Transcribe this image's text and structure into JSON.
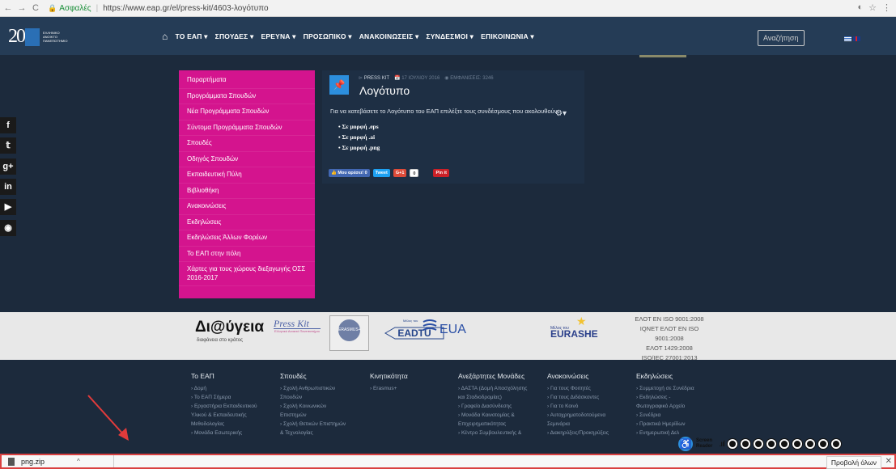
{
  "browser": {
    "secure_label": "Ασφαλές",
    "url": "https://www.eap.gr/el/press-kit/4603-λογότυπο",
    "back_icon": "back-arrow-icon",
    "forward_icon": "forward-arrow-icon",
    "reload_icon": "reload-icon",
    "lock_icon": "lock-icon"
  },
  "header": {
    "logo_mark": "20",
    "logo_text": "ΕΛΛΗΝΙΚΟ ΑΝΟΙΚΤΟ ΠΑΝΕΠΙΣΤΗΜΙΟ",
    "nav": [
      "ΤΟ ΕΑΠ ▾",
      "ΣΠΟΥΔΕΣ ▾",
      "ΕΡΕΥΝΑ ▾",
      "ΠΡΟΣΩΠΙΚΟ ▾",
      "ΑΝΑΚΟΙΝΩΣΕΙΣ ▾",
      "ΣΥΝΔΕΣΜΟΙ ▾",
      "ΕΠΙΚΟΙΝΩΝΙΑ ▾"
    ],
    "search_placeholder": "Αναζήτηση"
  },
  "social": [
    "f",
    "🐦",
    "g+",
    "in",
    "▶",
    "◉"
  ],
  "side_menu": [
    "Παραρτήματα",
    "Προγράμματα Σπουδών",
    "Νέα Προγράμματα Σπουδών",
    "Σύντομα Προγράμματα Σπουδών",
    "Σπουδές",
    "Οδηγός Σπουδών",
    "Εκπαιδευτική Πύλη",
    "Βιβλιοθήκη",
    "Ανακοινώσεις",
    "Εκδηλώσεις",
    "Εκδηλώσεις Άλλων Φορέων",
    "Το ΕΑΠ στην πόλη",
    "Χάρτες για τους χώρους διεξαγωγής ΟΣΣ 2016-2017"
  ],
  "article": {
    "category": "PRESS KIT",
    "date": "17 ΙΟΥΛΙΟΥ 2016",
    "views": "ΕΜΦΑΝΙΣΕΙΣ: 3246",
    "title": "Λογότυπο",
    "intro": "Για να κατεβάσετε το Λογότυπο του ΕΑΠ επιλέξτε τους συνδέσμους που ακολουθούν.",
    "links": [
      "Σε μορφή .eps",
      "Σε μορφή .ai",
      "Σε μορφή .png"
    ],
    "share": {
      "like": "👍 Μου αρέσει! 0",
      "tweet": "Tweet",
      "gplus": "G+1",
      "gplus_count": "0",
      "pin": "Pin it"
    }
  },
  "logos": {
    "diaygeia": "Δι@ύγεια",
    "diaygeia_sub": "διαφάνεια στο κράτος",
    "presskit": "Press Kit",
    "presskit_sub": "Ελληνικό Ανοικτό Πανεπιστήμιο",
    "erasmus": "ERASMUS+",
    "eadtu_small": "Μέλος του",
    "eadtu": "EADTU",
    "eua": "EUA",
    "eurashe_small": "Μέλος του",
    "eurashe": "EURASHE"
  },
  "iso": [
    "ΕΛΟΤ EN ISO 9001:2008",
    "IQNET ΕΛΟΤ EN ISO 9001:2008",
    "ΕΛΟΤ 1429:2008",
    "ISO/IEC 27001:2013"
  ],
  "footer": [
    {
      "title": "Το ΕΑΠ",
      "items": [
        "› Δομή",
        "› Το ΕΑΠ Σήμερα",
        "› Εργαστήρια Εκπαιδευτικού",
        "Υλικού & Εκπαιδευτικής",
        "Μεθοδολογίας",
        "› Μονάδα Εσωτερικής"
      ]
    },
    {
      "title": "Σπουδές",
      "items": [
        "› Σχολή Ανθρωπιστικών",
        "Σπουδών",
        "› Σχολή Κοινωνικών",
        "Επιστημών",
        "› Σχολή Θετικών Επιστημών",
        "& Τεχνολογίας"
      ]
    },
    {
      "title": "Κινητικότητα",
      "items": [
        "› Erasmus+"
      ]
    },
    {
      "title": "Ανεξάρτητες Μονάδες",
      "items": [
        "› ΔΑΣΤΑ (Δομή Απασχόλησης",
        "και Σταδιοδρομίας)",
        "› Γραφείο Διασύνδεσης",
        "› Μονάδα Καινοτομίας &",
        "Επιχειρηματικότητας",
        "› Κέντρο Συμβουλευτικής &"
      ]
    },
    {
      "title": "Ανακοινώσεις",
      "items": [
        "› Για τους Φοιτητές",
        "› Για τους Διδάσκοντες",
        "› Για το Κοινό",
        "› Αυτοχρηματοδοτούμενα",
        "Σεμινάρια",
        "› Διακηρύξεις/Προκηρύξεις"
      ]
    },
    {
      "title": "Εκδηλώσεις",
      "items": [
        "› Συμμετοχή σε Συνέδρια",
        "› Εκδηλώσεις -",
        "Φωτογραφικό Αρχείο",
        "› Συνέδρια",
        "› Πρακτικά Ημερίδων",
        "› Ενημερωτική Δελ"
      ]
    }
  ],
  "screen_reader": {
    "label_line1": "Screen",
    "label_line2": "Reader"
  },
  "download_bar": {
    "file_name": "png.zip",
    "show_all": "Προβολή όλων",
    "close": "✕"
  }
}
